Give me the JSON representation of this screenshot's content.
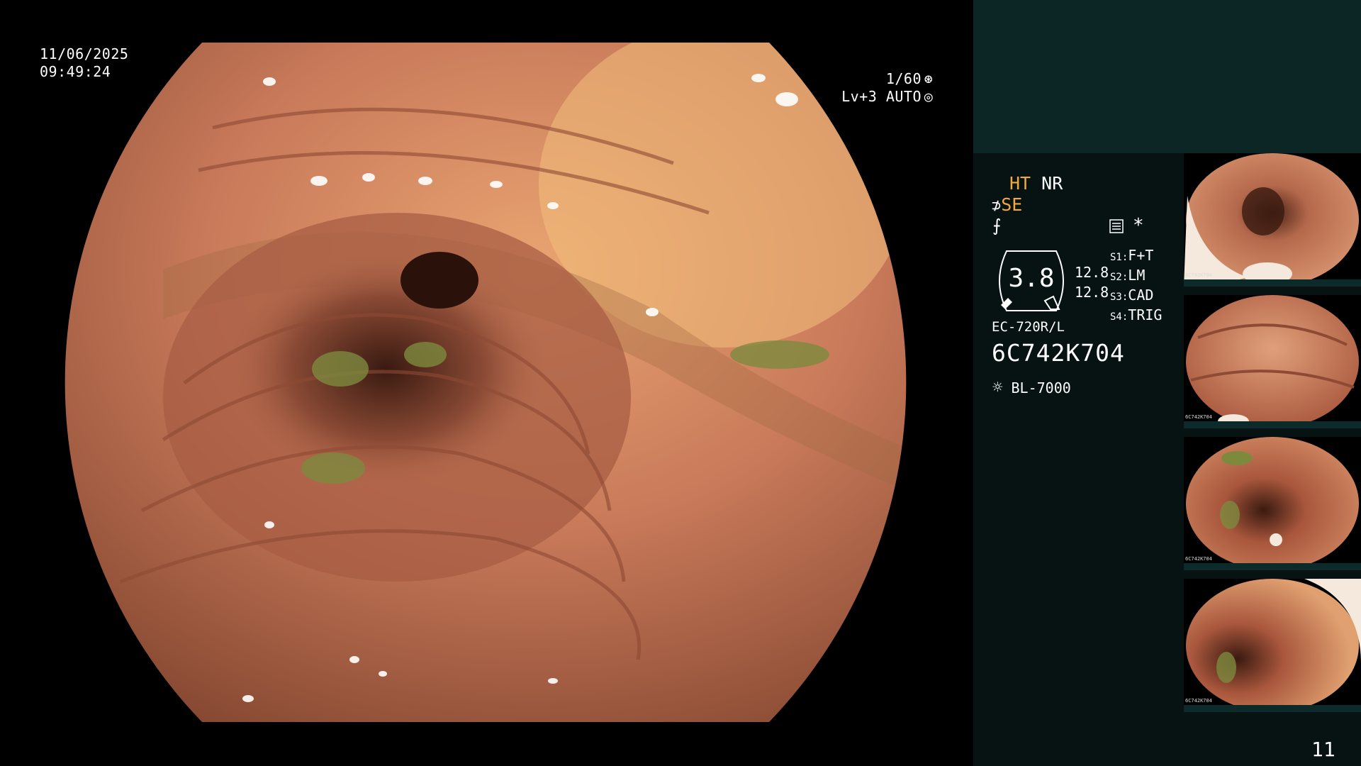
{
  "overlay": {
    "date": "11/06/2025",
    "time": "09:49:24",
    "shutter": "1/60",
    "shutter_icon": "shutter-icon",
    "iris": "Lv+3 AUTO",
    "iris_icon": "iris-icon"
  },
  "panel": {
    "mode_ht": "HT",
    "mode_nr": "NR",
    "mode_se": "SE",
    "structure_icon": "structure-icon",
    "f_icon": "f-curve-icon",
    "record_icon": "record-icon",
    "star": "*",
    "zoom": "3.8",
    "scale_a": "12.8",
    "scale_b": "12.8",
    "switches": [
      {
        "key": "S1",
        "value": "F+T"
      },
      {
        "key": "S2",
        "value": "LM"
      },
      {
        "key": "S3",
        "value": "CAD"
      },
      {
        "key": "S4",
        "value": "TRIG"
      }
    ],
    "scope_model": "EC-720R/L",
    "scope_serial": "6C742K704",
    "light_icon": "light-source-icon",
    "light_source": "BL-7000"
  },
  "thumbnails": [
    {
      "serial": "6C742K704"
    },
    {
      "serial": "6C742K704"
    },
    {
      "serial": "6C742K704"
    },
    {
      "serial": "6C742K704"
    }
  ],
  "page_number": "11",
  "colors": {
    "panel_bg": "#071313",
    "panel_top_bg": "#0c2626",
    "accent_orange": "#f2a93b",
    "mucosa": "#c9765a"
  }
}
